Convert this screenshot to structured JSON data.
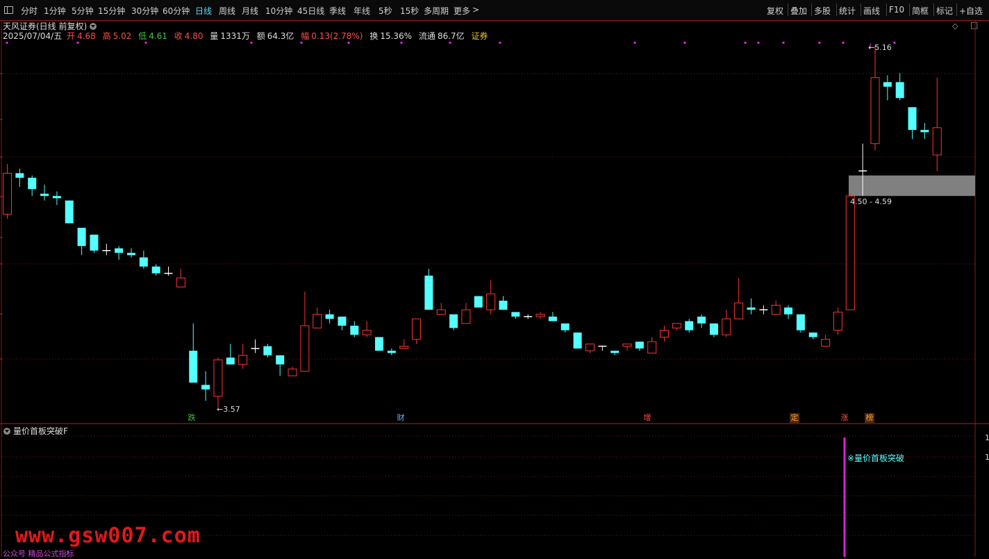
{
  "toolbar": {
    "periods": [
      "分时",
      "1分钟",
      "5分钟",
      "15分钟",
      "30分钟",
      "60分钟",
      "日线",
      "周线",
      "月线",
      "10分钟",
      "45日线",
      "季线",
      "年线",
      "5秒",
      "15秒",
      "多周期",
      "更多"
    ],
    "active_period": "日线",
    "right_buttons": [
      "复权",
      "叠加",
      "多股",
      "统计",
      "画线",
      "F10",
      "简框",
      "标记",
      "+自选"
    ]
  },
  "header": {
    "title": "天风证券(日线 前复权)",
    "date": "2025/07/04/五",
    "open_label": "开",
    "open": "4.68",
    "high_label": "高",
    "high": "5.02",
    "low_label": "低",
    "low": "4.61",
    "close_label": "收",
    "close": "4.80",
    "volume_label": "量",
    "volume": "1331万",
    "amount_label": "额",
    "amount": "64.3亿",
    "change_label": "幅",
    "change": "0.13(2.78%)",
    "turnover_label": "换",
    "turnover": "15.36%",
    "float_label": "流通",
    "float_value": "86.7亿",
    "sector": "证券"
  },
  "annotations": {
    "max_price": "5.16",
    "min_price": "3.57",
    "zone_label": "4.50 - 4.59"
  },
  "events": [
    "跌",
    "财",
    "增",
    "定",
    "涨",
    "榜"
  ],
  "sub_panel": {
    "title": "量价首板突破F",
    "signal_label": "※量价首板突破",
    "axis_values": [
      "1",
      "1"
    ]
  },
  "watermark": "www.gsw007.com",
  "footer_note": "公众号 精品公式指标",
  "colors": {
    "up": "#ff3333",
    "down": "#54ffff",
    "grid": "#7a1a1a",
    "signal": "#e020e0",
    "zone": "#808080"
  },
  "chart_data": {
    "type": "candlestick",
    "candles": [
      [
        4.42,
        4.6,
        4.4,
        4.64
      ],
      [
        4.6,
        4.58,
        4.54,
        4.62
      ],
      [
        4.58,
        4.53,
        4.5,
        4.59
      ],
      [
        4.51,
        4.5,
        4.48,
        4.55
      ],
      [
        4.5,
        4.49,
        4.46,
        4.52
      ],
      [
        4.48,
        4.38,
        4.38,
        4.48
      ],
      [
        4.36,
        4.28,
        4.24,
        4.36
      ],
      [
        4.33,
        4.26,
        4.25,
        4.33
      ],
      [
        4.26,
        4.26,
        4.24,
        4.29
      ],
      [
        4.27,
        4.25,
        4.22,
        4.28
      ],
      [
        4.25,
        4.24,
        4.23,
        4.27
      ],
      [
        4.23,
        4.19,
        4.18,
        4.26
      ],
      [
        4.19,
        4.16,
        4.15,
        4.2
      ],
      [
        4.16,
        4.16,
        4.15,
        4.19
      ],
      [
        4.1,
        4.14,
        4.1,
        4.18
      ],
      [
        3.82,
        3.68,
        3.68,
        3.94
      ],
      [
        3.67,
        3.65,
        3.6,
        3.73
      ],
      [
        3.62,
        3.78,
        3.57,
        3.79
      ],
      [
        3.79,
        3.76,
        3.76,
        3.85
      ],
      [
        3.76,
        3.8,
        3.74,
        3.85
      ],
      [
        3.83,
        3.83,
        3.81,
        3.87
      ],
      [
        3.84,
        3.8,
        3.79,
        3.85
      ],
      [
        3.8,
        3.76,
        3.71,
        3.8
      ],
      [
        3.71,
        3.74,
        3.71,
        3.75
      ],
      [
        3.73,
        3.93,
        3.73,
        4.08
      ],
      [
        3.92,
        3.98,
        3.92,
        4.01
      ],
      [
        3.98,
        3.96,
        3.94,
        4.0
      ],
      [
        3.97,
        3.93,
        3.91,
        3.97
      ],
      [
        3.93,
        3.89,
        3.88,
        3.95
      ],
      [
        3.89,
        3.91,
        3.88,
        3.95
      ],
      [
        3.88,
        3.82,
        3.82,
        3.88
      ],
      [
        3.82,
        3.81,
        3.8,
        3.83
      ],
      [
        3.83,
        3.84,
        3.83,
        3.87
      ],
      [
        3.87,
        3.96,
        3.85,
        3.96
      ],
      [
        4.15,
        4.0,
        4.0,
        4.18
      ],
      [
        3.98,
        4.0,
        3.98,
        4.03
      ],
      [
        3.98,
        3.92,
        3.91,
        3.98
      ],
      [
        3.94,
        4.0,
        3.94,
        4.03
      ],
      [
        4.06,
        4.01,
        4.01,
        4.06
      ],
      [
        4.0,
        4.07,
        3.98,
        4.13
      ],
      [
        4.04,
        4.0,
        4.0,
        4.06
      ],
      [
        3.99,
        3.97,
        3.96,
        3.99
      ],
      [
        3.97,
        3.97,
        3.96,
        3.98
      ],
      [
        3.97,
        3.98,
        3.96,
        3.99
      ],
      [
        3.97,
        3.95,
        3.95,
        3.99
      ],
      [
        3.94,
        3.91,
        3.9,
        3.94
      ],
      [
        3.9,
        3.83,
        3.83,
        3.9
      ],
      [
        3.82,
        3.85,
        3.81,
        3.85
      ],
      [
        3.84,
        3.84,
        3.82,
        3.84
      ],
      [
        3.82,
        3.81,
        3.8,
        3.82
      ],
      [
        3.84,
        3.85,
        3.82,
        3.85
      ],
      [
        3.86,
        3.83,
        3.82,
        3.86
      ],
      [
        3.81,
        3.86,
        3.81,
        3.88
      ],
      [
        3.88,
        3.91,
        3.86,
        3.93
      ],
      [
        3.92,
        3.94,
        3.91,
        3.94
      ],
      [
        3.95,
        3.91,
        3.9,
        3.96
      ],
      [
        3.97,
        3.94,
        3.92,
        3.98
      ],
      [
        3.94,
        3.89,
        3.88,
        3.94
      ],
      [
        3.89,
        3.96,
        3.88,
        4.0
      ],
      [
        3.96,
        4.03,
        3.96,
        4.14
      ],
      [
        4.01,
        4.0,
        3.98,
        4.05
      ],
      [
        4.0,
        4.0,
        3.98,
        4.02
      ],
      [
        3.98,
        4.02,
        3.98,
        4.04
      ],
      [
        4.01,
        3.98,
        3.96,
        4.02
      ],
      [
        3.98,
        3.91,
        3.9,
        3.98
      ],
      [
        3.9,
        3.88,
        3.87,
        3.9
      ],
      [
        3.84,
        3.87,
        3.84,
        3.89
      ],
      [
        3.91,
        3.99,
        3.89,
        4.01
      ],
      [
        4.0,
        4.5,
        4.0,
        4.51
      ],
      [
        4.61,
        4.61,
        4.5,
        4.73
      ],
      [
        4.73,
        5.02,
        4.7,
        5.16
      ],
      [
        5.0,
        4.98,
        4.92,
        5.03
      ],
      [
        5.0,
        4.93,
        4.92,
        5.04
      ],
      [
        4.89,
        4.79,
        4.75,
        4.89
      ],
      [
        4.79,
        4.78,
        4.75,
        4.82
      ],
      [
        4.68,
        4.8,
        4.61,
        5.02
      ]
    ],
    "price_range": [
      3.5,
      5.19
    ]
  }
}
